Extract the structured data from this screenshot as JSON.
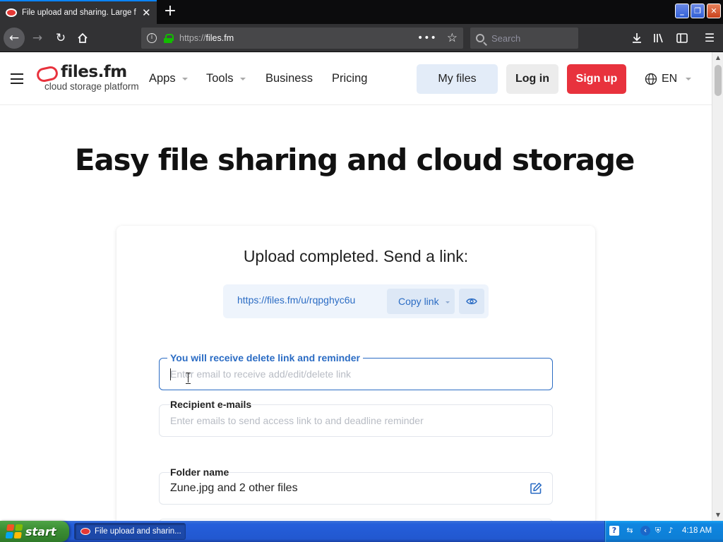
{
  "browser": {
    "tab_title": "File upload and sharing. Large file",
    "url_prefix": "https://",
    "url_host": "files.fm",
    "search_placeholder": "Search"
  },
  "site": {
    "logo_name": "files.fm",
    "logo_tagline": "cloud storage platform",
    "nav": {
      "apps": "Apps",
      "tools": "Tools",
      "business": "Business",
      "pricing": "Pricing"
    },
    "my_files": "My files",
    "log_in": "Log in",
    "sign_up": "Sign up",
    "language": "EN",
    "accent_color": "#e8323d",
    "link_color": "#2b6cc4"
  },
  "hero": {
    "title": "Easy file sharing and cloud storage"
  },
  "upload": {
    "heading": "Upload completed. Send a link:",
    "share_url": "https://files.fm/u/rqpghyc6u",
    "copy_link": "Copy link",
    "delete_link_label": "You will receive delete link and reminder",
    "delete_link_placeholder": "Enter email to receive add/edit/delete link",
    "recipients_label": "Recipient e-mails",
    "recipients_placeholder": "Enter emails to send access link to and deadline reminder",
    "folder_label": "Folder name",
    "folder_value": "Zune.jpg and 2 other files"
  },
  "taskbar": {
    "start": "start",
    "task_label": "File upload and sharin...",
    "clock": "4:18 AM"
  }
}
